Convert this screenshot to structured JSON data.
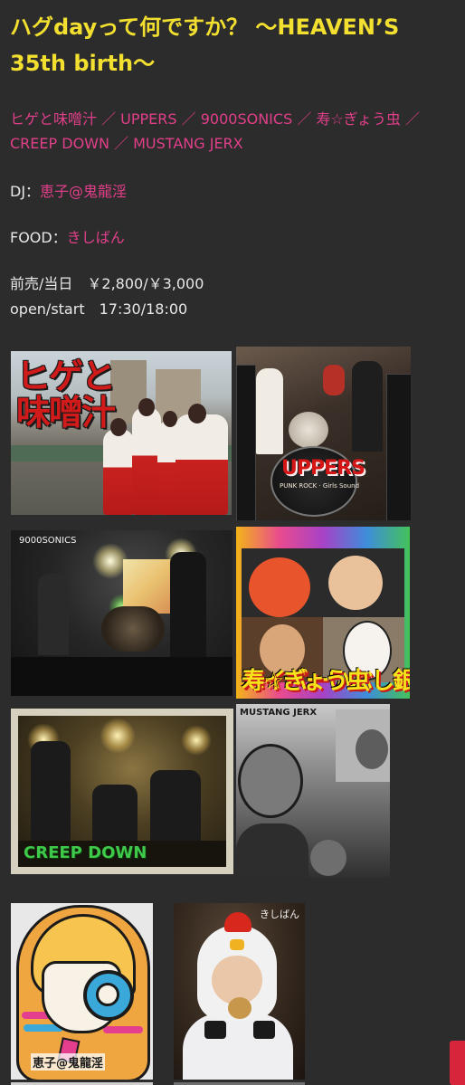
{
  "event": {
    "title": "ハグdayって何ですか？ 〜HEAVEN’S 35th birth〜",
    "lineup_line1": "ヒゲと味噌汁 ／ UPPERS ／ 9000SONICS ／ 寿☆ぎょう虫 ／",
    "lineup_line2": "CREEP DOWN ／ MUSTANG JERX",
    "dj_label": "DJ：",
    "dj_name": "恵子@鬼龍淫",
    "food_label": "FOOD：",
    "food_name": "きしばん",
    "price": "前売/当日　￥2,800/￥3,000",
    "time": "open/start　17:30/18:00"
  },
  "photos": {
    "p1_caption": "ヒゲと味噌汁",
    "p2_caption": "UPPERS",
    "p2_sub": "PUNK ROCK · Girls Sound",
    "p3_caption": "9000SONICS",
    "p4_caption_top": "ハイパーいぶし銀パンクバンド",
    "p4_caption": "寿☆ぎょう虫",
    "p5_caption": "CREEP DOWN",
    "p6_caption": "MUSTANG JERX",
    "p7_caption": "恵子@鬼龍淫",
    "p8_caption": "きしばん"
  },
  "colors": {
    "background": "#2c2c2c",
    "title": "#f2df2f",
    "link": "#e23f8a",
    "text": "#e8e8e8"
  }
}
